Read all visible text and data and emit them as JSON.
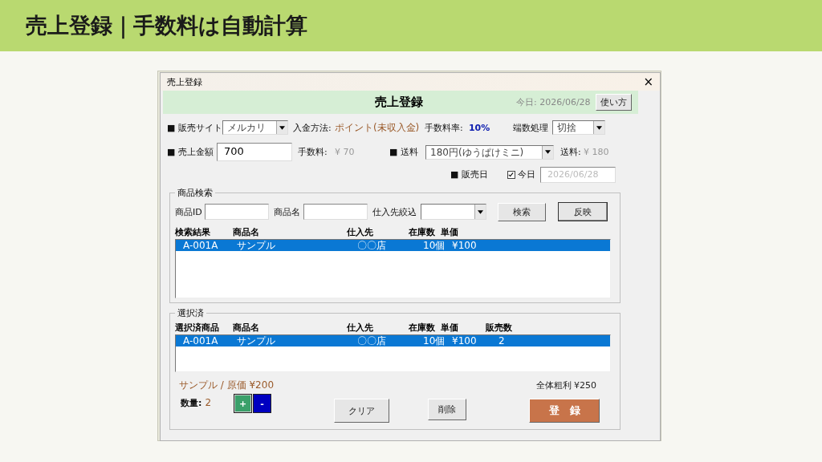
{
  "header": {
    "title": "売上登録｜手数料は自動計算"
  },
  "window": {
    "title": "売上登録",
    "close": "×"
  },
  "banner": {
    "title": "売上登録",
    "today": "今日: 2026/06/28",
    "help_button": "使い方"
  },
  "form": {
    "site_label": "■ 販売サイト",
    "site": "メルカリ",
    "payment_label": "入金方法:",
    "payment": "ポイント(未収入金)",
    "rate_label": "手数料率:",
    "rate": "10%",
    "rounding_label": "端数処理",
    "rounding": "切捨",
    "amount_label": "■ 売上金額",
    "amount": "700",
    "fee_label": "手数料:",
    "fee": "¥ 70",
    "shipping_label": "■ 送料",
    "shipping": "180円(ゆうぱけミニ)",
    "shipping_fee_label": "送料:",
    "shipping_fee": "¥ 180",
    "date_label": "■ 販売日",
    "today_check": {
      "label": "今日",
      "checked": true
    },
    "date": "2026/06/28"
  },
  "search": {
    "title": "商品検索",
    "id_label": "商品ID",
    "name_label": "商品名",
    "supplier_label": "仕入先絞込",
    "search_button": "検索",
    "apply_button": "反映",
    "columns": [
      "検索結果",
      "商品名",
      "仕入先",
      "在庫数",
      "単価"
    ],
    "rows": [
      {
        "cells": [
          "A-001A",
          "サンプル",
          "〇〇店",
          "10個",
          "¥100"
        ],
        "selected": true
      }
    ]
  },
  "selected": {
    "title": "選択済",
    "columns": [
      "選択済商品",
      "商品名",
      "仕入先",
      "在庫数",
      "単価",
      "販売数"
    ],
    "rows": [
      {
        "cells": [
          "A-001A",
          "サンプル",
          "〇〇店",
          "10個",
          "¥100",
          "2"
        ],
        "selected": true
      }
    ],
    "item_info": "サンプル / 原価 ¥200",
    "quantity_label": "数量:",
    "quantity": "2",
    "plus_button": "+",
    "minus_button": "-",
    "total_profit": "全体粗利  ¥250",
    "clear_button": "クリア",
    "delete_button": "削除",
    "register_button": "登　録"
  }
}
